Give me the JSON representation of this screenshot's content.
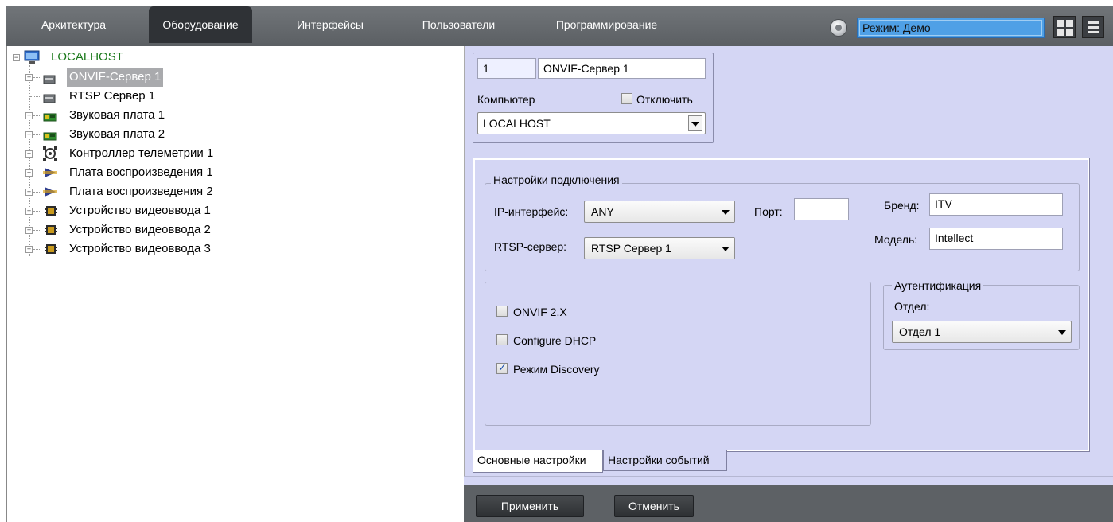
{
  "nav": {
    "tabs": [
      {
        "label": "Архитектура"
      },
      {
        "label": "Оборудование"
      },
      {
        "label": "Интерфейсы"
      },
      {
        "label": "Пользователи"
      },
      {
        "label": "Программирование"
      }
    ],
    "active_tab": "Оборудование",
    "mode_text": "Режим: Демо"
  },
  "tree": {
    "root": "LOCALHOST",
    "items": [
      {
        "label": "ONVIF-Сервер 1",
        "icon": "server-icon",
        "selected": true,
        "expandable": true
      },
      {
        "label": "RTSP Сервер 1",
        "icon": "server-icon",
        "selected": false,
        "expandable": false
      },
      {
        "label": "Звуковая плата 1",
        "icon": "sound-card-icon",
        "selected": false,
        "expandable": true
      },
      {
        "label": "Звуковая плата 2",
        "icon": "sound-card-icon",
        "selected": false,
        "expandable": true
      },
      {
        "label": "Контроллер телеметрии 1",
        "icon": "telemetry-controller-icon",
        "selected": false,
        "expandable": true
      },
      {
        "label": "Плата воспроизведения 1",
        "icon": "playback-board-icon",
        "selected": false,
        "expandable": true
      },
      {
        "label": "Плата воспроизведения 2",
        "icon": "playback-board-icon",
        "selected": false,
        "expandable": true
      },
      {
        "label": "Устройство видеоввода 1",
        "icon": "video-input-icon",
        "selected": false,
        "expandable": true
      },
      {
        "label": "Устройство видеоввода 2",
        "icon": "video-input-icon",
        "selected": false,
        "expandable": true
      },
      {
        "label": "Устройство видеоввода 3",
        "icon": "video-input-icon",
        "selected": false,
        "expandable": true
      }
    ]
  },
  "object": {
    "id": "1",
    "name": "ONVIF-Сервер 1",
    "computer_label": "Компьютер",
    "disable_label": "Отключить",
    "computer_value": "LOCALHOST"
  },
  "connection": {
    "group_title": "Настройки подключения",
    "ip_label": "IP-интерфейс:",
    "ip_value": "ANY",
    "port_label": "Порт:",
    "port_value": "",
    "rtsp_label": "RTSP-сервер:",
    "rtsp_value": "RTSP Сервер 1",
    "brand_label": "Бренд:",
    "brand_value": "ITV",
    "model_label": "Модель:",
    "model_value": "Intellect"
  },
  "options": {
    "onvif2x": {
      "label": "ONVIF 2.X",
      "checked": false
    },
    "dhcp": {
      "label": "Configure DHCP",
      "checked": false
    },
    "discovery": {
      "label": "Режим Discovery",
      "checked": true
    }
  },
  "auth": {
    "group_title": "Аутентификация",
    "dept_label": "Отдел:",
    "dept_value": "Отдел 1"
  },
  "tabs": {
    "main": "Основные настройки",
    "events": "Настройки событий"
  },
  "buttons": {
    "apply": "Применить",
    "cancel": "Отменить"
  },
  "colors": {
    "panel_bg": "#d4d6f4",
    "tab_bar": "#65696d",
    "mode_field": "#4fa0e6",
    "selected_item": "#a9aaad"
  }
}
